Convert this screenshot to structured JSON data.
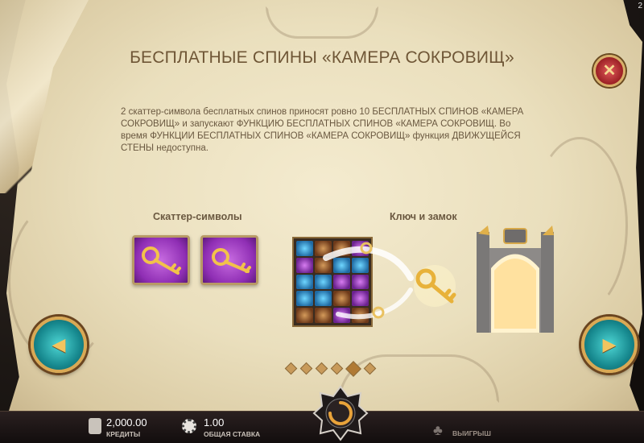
{
  "page": {
    "title": "БЕСПЛАТНЫЕ СПИНЫ «КАМЕРА СОКРОВИЩ»",
    "description": "2 скаттер-символа бесплатных спинов приносят ровно 10 БЕСПЛАТНЫХ СПИНОВ «КАМЕРА СОКРОВИЩ» и запускают ФУНКЦИЮ БЕСПЛАТНЫХ СПИНОВ «КАМЕРА СОКРОВИЩ. Во время ФУНКЦИИ БЕСПЛАТНЫХ СПИНОВ «КАМЕРА СОКРОВИЩ» функция ДВИЖУЩЕЙСЯ СТЕНЫ недоступна.",
    "section_scatter": "Скаттер-символы",
    "section_key": "Ключ и замок",
    "corner_number": "2"
  },
  "controls": {
    "close_glyph": "✕",
    "prev_glyph": "◀",
    "next_glyph": "▶"
  },
  "pager": {
    "count": 6,
    "active_index": 4
  },
  "grid": {
    "rows": [
      [
        "blue",
        "brown",
        "brown",
        "purple"
      ],
      [
        "purple",
        "brown",
        "blue",
        "blue"
      ],
      [
        "blue",
        "blue",
        "purple",
        "purple"
      ],
      [
        "blue",
        "blue",
        "brown",
        "purple"
      ],
      [
        "brown",
        "brown",
        "purple",
        "brown"
      ]
    ]
  },
  "bottom_bar": {
    "credits_value": "2,000.00",
    "credits_label": "КРЕДИТЫ",
    "bet_value": "1.00",
    "bet_label": "ОБЩАЯ СТАВКА",
    "win_label": "ВЫИГРЫШ"
  },
  "colors": {
    "parchment": "#eadfbd",
    "title_text": "#6f5636",
    "nav_teal": "#17898f",
    "gold": "#d9a955",
    "scatter_purple": "#8f2eb4"
  }
}
